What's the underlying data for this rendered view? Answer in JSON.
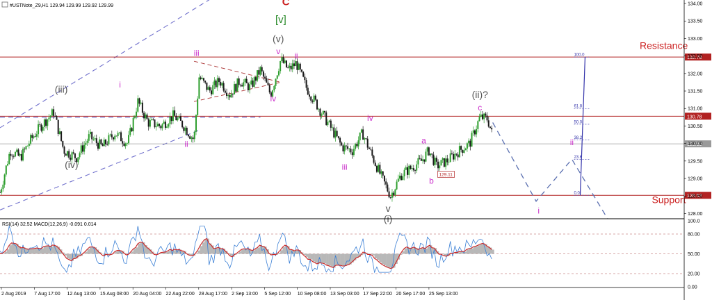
{
  "header": {
    "symbol_text": "#USTNote_Z9,H1  129.94 129.99 129.92 129.99"
  },
  "indicator": {
    "title": "RSI(14) 32.52 MACD(12,26,9) -0.091 0.014",
    "levels": [
      "100.0",
      "80.00",
      "50.00",
      "20.00",
      "0.00"
    ]
  },
  "colors": {
    "candle_up": "#2e9e2e",
    "candle_down": "#1a1a1a",
    "level_line": "#b22222",
    "pink_label": "#cc33cc",
    "grey_label": "#555555",
    "red_label": "#cc2222",
    "green_label": "#2a8a2a",
    "fib": "#3333aa",
    "rsi": "#3a7fd5",
    "signal": "#cc2222",
    "macd_hist": "#b8b8b8",
    "channel": "#7070cc"
  },
  "chart_data": {
    "type": "candlestick",
    "symbol": "#USTNote_Z9",
    "timeframe": "H1",
    "price_axis": {
      "ticks": [
        "134.00",
        "133.50",
        "133.00",
        "132.50",
        "132.00",
        "131.50",
        "131.00",
        "130.50",
        "130.00",
        "129.50",
        "129.00",
        "128.50",
        "128.00"
      ],
      "range": [
        127.85,
        134.1
      ]
    },
    "time_axis": {
      "labels": [
        "2 Aug 2019",
        "7 Aug 17:00",
        "12 Aug 13:00",
        "15 Aug 08:00",
        "20 Aug 04:00",
        "22 Aug 22:00",
        "28 Aug 17:00",
        "2 Sep 13:00",
        "5 Sep 12:00",
        "10 Sep 08:00",
        "13 Sep 03:00",
        "17 Sep 22:00",
        "20 Sep 17:00",
        "25 Sep 13:00"
      ]
    },
    "price_path": [
      [
        0,
        128.6
      ],
      [
        4,
        129.8
      ],
      [
        8,
        129.6
      ],
      [
        12,
        130.1
      ],
      [
        16,
        130.5
      ],
      [
        21,
        130.9
      ],
      [
        25,
        129.8
      ],
      [
        30,
        129.6
      ],
      [
        35,
        130.2
      ],
      [
        40,
        129.9
      ],
      [
        45,
        130.3
      ],
      [
        50,
        130.0
      ],
      [
        54,
        131.2
      ],
      [
        58,
        130.6
      ],
      [
        63,
        130.5
      ],
      [
        68,
        130.8
      ],
      [
        72,
        130.5
      ],
      [
        76,
        130.1
      ],
      [
        78,
        131.9
      ],
      [
        82,
        131.5
      ],
      [
        86,
        131.8
      ],
      [
        90,
        131.4
      ],
      [
        94,
        131.8
      ],
      [
        98,
        131.6
      ],
      [
        102,
        132.1
      ],
      [
        106,
        131.4
      ],
      [
        110,
        132.4
      ],
      [
        113,
        132.1
      ],
      [
        116,
        132.3
      ],
      [
        120,
        131.6
      ],
      [
        125,
        131.0
      ],
      [
        130,
        130.4
      ],
      [
        134,
        129.9
      ],
      [
        138,
        129.8
      ],
      [
        142,
        130.3
      ],
      [
        146,
        129.6
      ],
      [
        150,
        128.95
      ],
      [
        153,
        128.5
      ],
      [
        157,
        129.1
      ],
      [
        161,
        129.3
      ],
      [
        165,
        129.5
      ],
      [
        168,
        129.8
      ],
      [
        171,
        129.35
      ],
      [
        175,
        129.5
      ],
      [
        180,
        129.8
      ],
      [
        184,
        130.0
      ],
      [
        188,
        130.75
      ],
      [
        191,
        130.7
      ],
      [
        193,
        130.2
      ]
    ],
    "horizontal_levels": [
      {
        "price": 132.47,
        "label": "132.79"
      },
      {
        "price": 130.78,
        "label": "130.78"
      },
      {
        "price": 129.99,
        "label": "129.99"
      },
      {
        "price": 128.52,
        "label": "128.52"
      }
    ],
    "fibonacci": [
      {
        "ratio": "100.0",
        "price": 132.47
      },
      {
        "ratio": "61.8",
        "price": 131.0
      },
      {
        "ratio": "50.0",
        "price": 130.55
      },
      {
        "ratio": "38.2",
        "price": 130.1
      },
      {
        "ratio": "23.6",
        "price": 129.55
      },
      {
        "ratio": "0.0",
        "price": 128.52
      }
    ],
    "price_box": {
      "label": "129.11",
      "t": 172,
      "price": 129.11
    },
    "wave_labels": [
      {
        "text": "(iii)",
        "t": 24,
        "price": 131.45,
        "color": "grey"
      },
      {
        "text": "(iv)",
        "t": 28,
        "price": 129.3,
        "color": "grey"
      },
      {
        "text": "i",
        "t": 47,
        "price": 131.6,
        "color": "pink"
      },
      {
        "text": "ii",
        "t": 73,
        "price": 129.9,
        "color": "pink"
      },
      {
        "text": "iii",
        "t": 77,
        "price": 132.5,
        "color": "pink"
      },
      {
        "text": "iv",
        "t": 107,
        "price": 131.2,
        "color": "pink"
      },
      {
        "text": "v",
        "t": 109,
        "price": 132.55,
        "color": "pink"
      },
      {
        "text": "ii",
        "t": 116,
        "price": 132.42,
        "color": "pink"
      },
      {
        "text": "C",
        "t": 112,
        "price": 133.95,
        "color": "red"
      },
      {
        "text": "[v]",
        "t": 110,
        "price": 133.45,
        "color": "green"
      },
      {
        "text": "(v)",
        "t": 109,
        "price": 132.9,
        "color": "grey"
      },
      {
        "text": "iii",
        "t": 135,
        "price": 129.25,
        "color": "pink"
      },
      {
        "text": "iv",
        "t": 145,
        "price": 130.65,
        "color": "pink"
      },
      {
        "text": "v",
        "t": 152,
        "price": 128.05,
        "color": "grey"
      },
      {
        "text": "(i)",
        "t": 152,
        "price": 127.75,
        "color": "grey"
      },
      {
        "text": "a",
        "t": 166,
        "price": 130.0,
        "color": "pink"
      },
      {
        "text": "b",
        "t": 169,
        "price": 128.85,
        "color": "pink"
      },
      {
        "text": "c",
        "t": 188,
        "price": 130.95,
        "color": "pink"
      },
      {
        "text": "(ii)?",
        "t": 188,
        "price": 131.3,
        "color": "grey"
      },
      {
        "text": "i",
        "t": 211,
        "price": 128.0,
        "color": "pink"
      },
      {
        "text": "ii",
        "t": 224,
        "price": 129.95,
        "color": "pink"
      }
    ],
    "projection": [
      [
        193,
        130.6
      ],
      [
        210,
        128.35
      ],
      [
        224,
        129.55
      ],
      [
        238,
        127.85
      ]
    ],
    "channel_lines": [
      {
        "from": [
          0,
          130.45
        ],
        "to": [
          102,
          135.0
        ]
      },
      {
        "from": [
          0,
          128.1
        ],
        "to": [
          78,
          130.38
        ]
      },
      {
        "from": [
          0,
          130.75
        ],
        "to": [
          102,
          130.75
        ]
      }
    ],
    "triangle": [
      [
        76,
        132.35
      ],
      [
        110,
        131.75
      ],
      [
        76,
        131.2
      ]
    ],
    "annotations": [
      {
        "text": "Resistance",
        "t": 260,
        "price": 132.7
      },
      {
        "text": "Support",
        "t": 262,
        "price": 128.3
      }
    ]
  }
}
